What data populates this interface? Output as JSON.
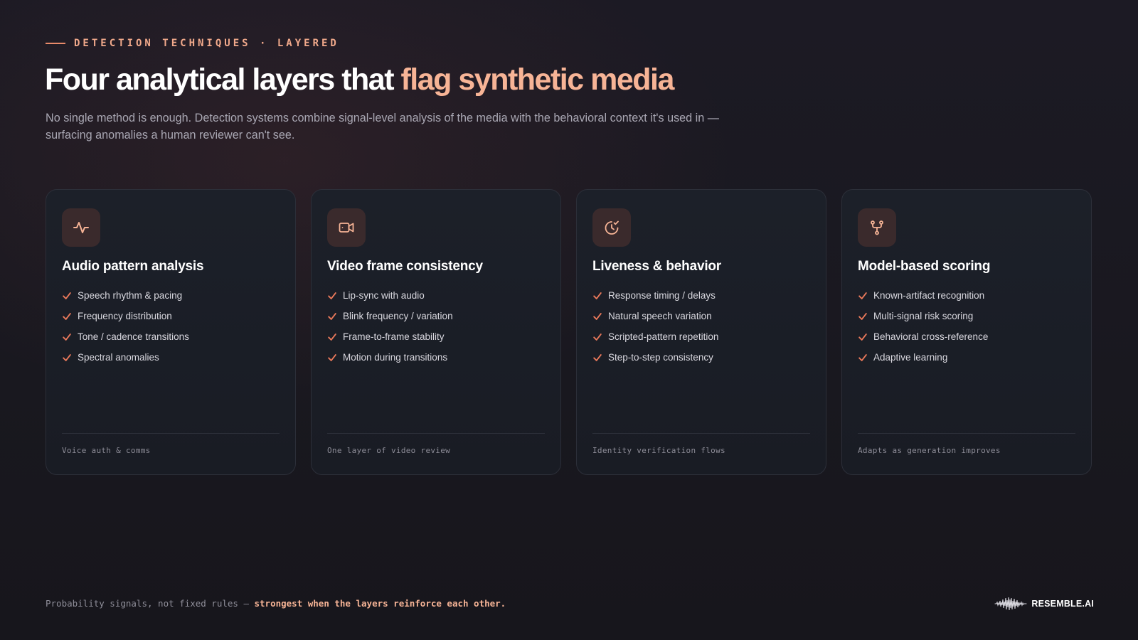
{
  "eyebrow": "DETECTION TECHNIQUES · LAYERED",
  "title": {
    "main": "Four analytical layers that ",
    "accent": "flag synthetic media"
  },
  "subtitle": "No single method is enough. Detection systems combine signal-level analysis of the media with the behavioral context it's used in — surfacing anomalies a human reviewer can't see.",
  "colors": {
    "accent": "#f7b496",
    "eyebrow": "#f1a98b",
    "check": "#e8785a",
    "icon_bg": "#3a2a2c"
  },
  "cards": [
    {
      "icon": "activity-pulse-icon",
      "title": "Audio pattern analysis",
      "items": [
        "Speech rhythm & pacing",
        "Frequency distribution",
        "Tone / cadence transitions",
        "Spectral anomalies"
      ],
      "footer": "Voice auth & comms"
    },
    {
      "icon": "video-camera-icon",
      "title": "Video frame consistency",
      "items": [
        "Lip-sync with audio",
        "Blink frequency / variation",
        "Frame-to-frame stability",
        "Motion during transitions"
      ],
      "footer": "One layer of video review"
    },
    {
      "icon": "clock-check-icon",
      "title": "Liveness & behavior",
      "items": [
        "Response timing / delays",
        "Natural speech variation",
        "Scripted-pattern repetition",
        "Step-to-step consistency"
      ],
      "footer": "Identity verification flows"
    },
    {
      "icon": "git-merge-icon",
      "title": "Model-based scoring",
      "items": [
        "Known-artifact recognition",
        "Multi-signal risk scoring",
        "Behavioral cross-reference",
        "Adaptive learning"
      ],
      "footer": "Adapts as generation improves"
    }
  ],
  "footnote": {
    "plain": "Probability signals, not fixed rules — ",
    "bold": "strongest when the layers reinforce each other."
  },
  "brand": {
    "logo_icon": "waveform-logo-icon",
    "name": "RESEMBLE.AI"
  }
}
